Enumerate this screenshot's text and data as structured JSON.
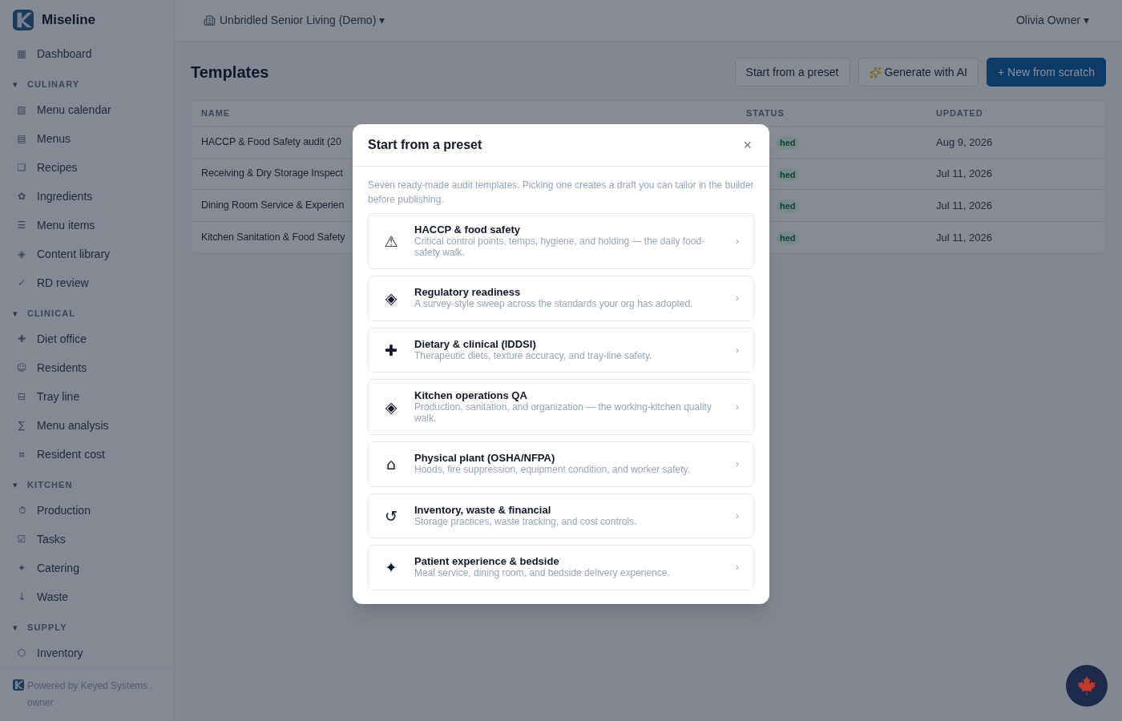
{
  "app": {
    "name": "Miseline"
  },
  "sidebar": {
    "items": [
      {
        "kind": "link",
        "icon": "▦",
        "label": "Dashboard"
      },
      {
        "kind": "section",
        "caret": "▾",
        "label": "CULINARY"
      },
      {
        "kind": "link",
        "icon": "▧",
        "label": "Menu calendar"
      },
      {
        "kind": "link",
        "icon": "▤",
        "label": "Menus"
      },
      {
        "kind": "link",
        "icon": "❏",
        "label": "Recipes"
      },
      {
        "kind": "link",
        "icon": "✿",
        "label": "Ingredients"
      },
      {
        "kind": "link",
        "icon": "☰",
        "label": "Menu items"
      },
      {
        "kind": "link",
        "icon": "◈",
        "label": "Content library"
      },
      {
        "kind": "link",
        "icon": "✓",
        "label": "RD review"
      },
      {
        "kind": "section",
        "caret": "▾",
        "label": "CLINICAL"
      },
      {
        "kind": "link",
        "icon": "✚",
        "label": "Diet office"
      },
      {
        "kind": "link",
        "icon": "☺",
        "label": "Residents"
      },
      {
        "kind": "link",
        "icon": "⊟",
        "label": "Tray line"
      },
      {
        "kind": "link",
        "icon": "∑",
        "label": "Menu analysis"
      },
      {
        "kind": "link",
        "icon": "¤",
        "label": "Resident cost"
      },
      {
        "kind": "section",
        "caret": "▾",
        "label": "KITCHEN"
      },
      {
        "kind": "link",
        "icon": "⏱",
        "label": "Production"
      },
      {
        "kind": "link",
        "icon": "☑",
        "label": "Tasks"
      },
      {
        "kind": "link",
        "icon": "✦",
        "label": "Catering"
      },
      {
        "kind": "link",
        "icon": "↓",
        "label": "Waste"
      },
      {
        "kind": "section",
        "caret": "▾",
        "label": "SUPPLY"
      },
      {
        "kind": "link",
        "icon": "⬡",
        "label": "Inventory"
      }
    ],
    "footer": "Powered by Keyed Systems . owner"
  },
  "topbar": {
    "org": "Unbridled Senior Living (Demo) ▾",
    "user": "Olivia Owner ▾"
  },
  "page": {
    "title": "Templates",
    "buttons": [
      {
        "kind": "outline",
        "label": "Start from a preset"
      },
      {
        "kind": "ai",
        "label": "Generate with AI"
      },
      {
        "kind": "primary",
        "label": "+ New from scratch"
      }
    ]
  },
  "table": {
    "columns": [
      "NAME",
      "STATUS",
      "UPDATED"
    ],
    "rows": [
      {
        "name": "HACCP & Food Safety audit (20",
        "status": "hed",
        "updated": "Aug 9, 2026"
      },
      {
        "name": "Receiving & Dry Storage Inspect",
        "status": "hed",
        "updated": "Jul 11, 2026"
      },
      {
        "name": "Dining Room Service & Experien",
        "status": "hed",
        "updated": "Jul 11, 2026"
      },
      {
        "name": "Kitchen Sanitation & Food Safety",
        "status": "hed",
        "updated": "Jul 11, 2026"
      }
    ]
  },
  "modal": {
    "title": "Start from a preset",
    "close": "×",
    "description": "Seven ready-made audit templates. Picking one creates a draft you can tailor in the builder before publishing.",
    "presets": [
      {
        "icon": "⚠",
        "title": "HACCP & food safety",
        "description": "Critical control points, temps, hygiene, and holding — the daily food-safety walk.",
        "chevron": "›"
      },
      {
        "icon": "◈",
        "title": "Regulatory readiness",
        "description": "A survey-style sweep across the standards your org has adopted.",
        "chevron": "›"
      },
      {
        "icon": "✚",
        "title": "Dietary & clinical (IDDSI)",
        "description": "Therapeutic diets, texture accuracy, and tray-line safety.",
        "chevron": "›"
      },
      {
        "icon": "◈",
        "title": "Kitchen operations QA",
        "description": "Production, sanitation, and organization — the working-kitchen quality walk.",
        "chevron": "›"
      },
      {
        "icon": "⌂",
        "title": "Physical plant (OSHA/NFPA)",
        "description": "Hoods, fire suppression, equipment condition, and worker safety.",
        "chevron": "›"
      },
      {
        "icon": "↺",
        "title": "Inventory, waste & financial",
        "description": "Storage practices, waste tracking, and cost controls.",
        "chevron": "›"
      },
      {
        "icon": "✦",
        "title": "Patient experience & bedside",
        "description": "Meal service, dining room, and bedside delivery experience.",
        "chevron": "›"
      }
    ]
  }
}
